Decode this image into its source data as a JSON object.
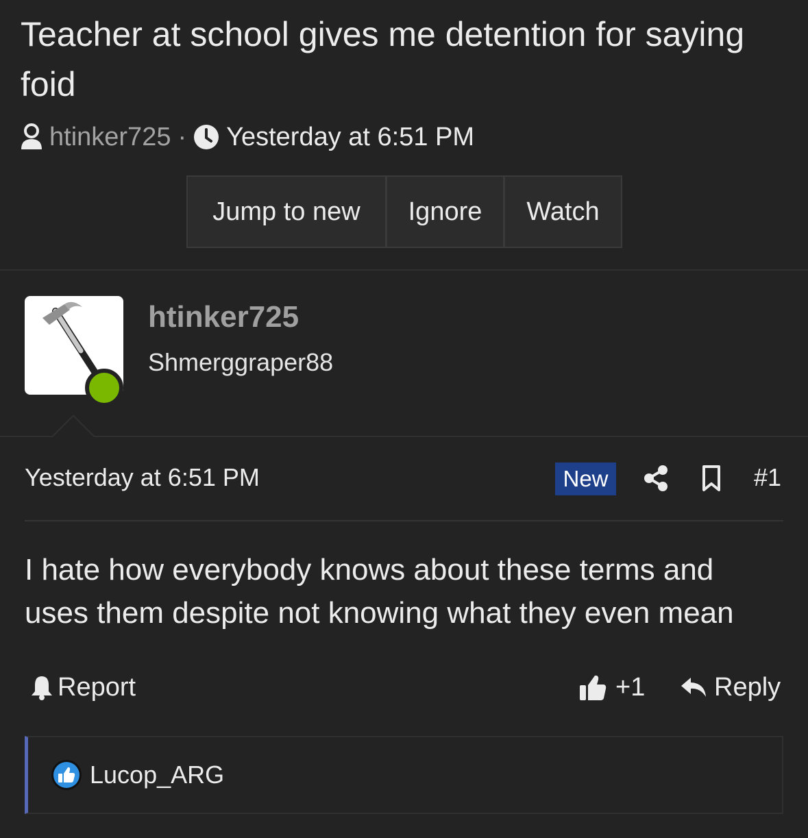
{
  "thread": {
    "title": "Teacher at school gives me detention for saying foid",
    "author": "htinker725",
    "separator": "·",
    "date": "Yesterday at 6:51 PM"
  },
  "actions": {
    "jump_label": "Jump to new",
    "ignore_label": "Ignore",
    "watch_label": "Watch"
  },
  "user": {
    "name": "htinker725",
    "title": "Shmerggraper88",
    "online": true,
    "online_color": "#7ab800",
    "avatar_icon": "hammer-icon"
  },
  "post": {
    "date": "Yesterday at 6:51 PM",
    "badge": "New",
    "badge_color": "#1e3f8a",
    "number": "#1",
    "body": "I hate how everybody knows about these terms and uses them despite not knowing what they even mean",
    "report_label": "Report",
    "like_count": "+1",
    "reply_label": "Reply"
  },
  "reactions": {
    "users": [
      "Lucop_ARG"
    ],
    "accent_color": "#5668b8"
  }
}
